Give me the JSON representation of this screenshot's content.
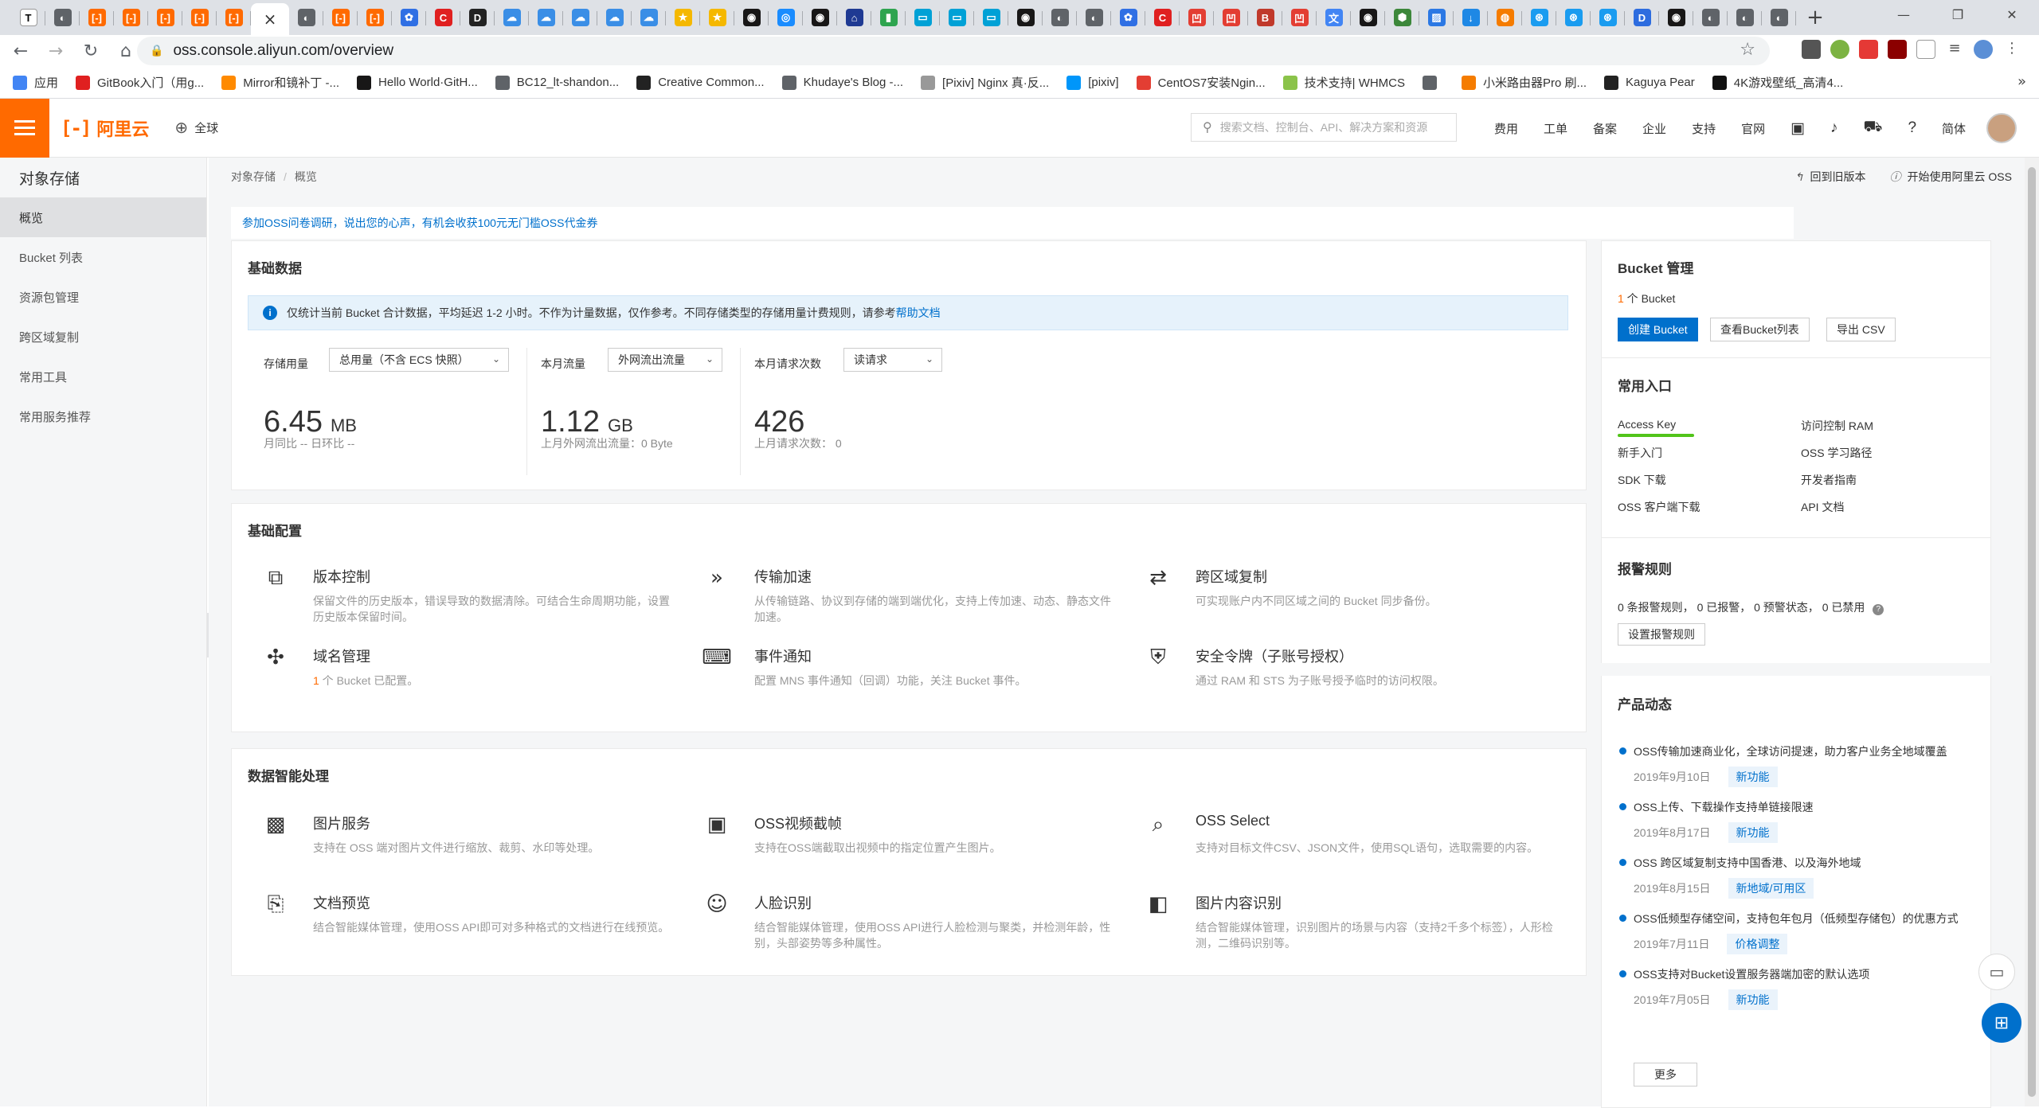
{
  "browser": {
    "tabs": [
      {
        "icon": "text-icon",
        "letter": "T",
        "color": "#ffffff",
        "fg": "#000"
      },
      {
        "icon": "globe-icon",
        "letter": "◐",
        "color": "#5f6368",
        "fg": "#fff"
      },
      {
        "icon": "aliyun-icon",
        "letter": "[-]",
        "color": "#ff6a00",
        "fg": "#fff"
      },
      {
        "icon": "aliyun-icon",
        "letter": "[-]",
        "color": "#ff6a00",
        "fg": "#fff"
      },
      {
        "icon": "aliyun-icon",
        "letter": "[-]",
        "color": "#ff6a00",
        "fg": "#fff"
      },
      {
        "icon": "aliyun-icon",
        "letter": "[-]",
        "color": "#ff6a00",
        "fg": "#fff"
      },
      {
        "icon": "aliyun-icon",
        "letter": "[-]",
        "color": "#ff6a00",
        "fg": "#fff"
      },
      {
        "icon": "close-icon",
        "letter": "×",
        "active": true
      },
      {
        "icon": "globe-icon",
        "letter": "◐",
        "color": "#5f6368",
        "fg": "#fff"
      },
      {
        "icon": "aliyun-icon",
        "letter": "[-]",
        "color": "#ff6a00",
        "fg": "#fff"
      },
      {
        "icon": "aliyun-icon",
        "letter": "[-]",
        "color": "#ff6a00",
        "fg": "#fff"
      },
      {
        "icon": "settings-icon",
        "letter": "✿",
        "color": "#2f6fe4",
        "fg": "#fff"
      },
      {
        "icon": "cloud-c-icon",
        "letter": "C",
        "color": "#e02020",
        "fg": "#fff"
      },
      {
        "icon": "d-icon",
        "letter": "D",
        "color": "#222",
        "fg": "#fff"
      },
      {
        "icon": "cloud-icon",
        "letter": "☁",
        "color": "#3a8ee6",
        "fg": "#fff"
      },
      {
        "icon": "cloud-icon",
        "letter": "☁",
        "color": "#3a8ee6",
        "fg": "#fff"
      },
      {
        "icon": "cloud-icon",
        "letter": "☁",
        "color": "#3a8ee6",
        "fg": "#fff"
      },
      {
        "icon": "cloud-icon",
        "letter": "☁",
        "color": "#3a8ee6",
        "fg": "#fff"
      },
      {
        "icon": "cloud-icon",
        "letter": "☁",
        "color": "#3a8ee6",
        "fg": "#fff"
      },
      {
        "icon": "star-icon",
        "letter": "★",
        "color": "#f5b800",
        "fg": "#fff"
      },
      {
        "icon": "star-icon",
        "letter": "★",
        "color": "#f5b800",
        "fg": "#fff"
      },
      {
        "icon": "github-icon",
        "letter": "◉",
        "color": "#181717",
        "fg": "#fff"
      },
      {
        "icon": "blue-circle-icon",
        "letter": "◎",
        "color": "#1a8cff",
        "fg": "#fff"
      },
      {
        "icon": "github-icon",
        "letter": "◉",
        "color": "#181717",
        "fg": "#fff"
      },
      {
        "icon": "house-icon",
        "letter": "⌂",
        "color": "#1f3a93",
        "fg": "#fff"
      },
      {
        "icon": "chart-icon",
        "letter": "▮",
        "color": "#2ea44f",
        "fg": "#fff"
      },
      {
        "icon": "tv-icon",
        "letter": "▭",
        "color": "#00a1d6",
        "fg": "#fff"
      },
      {
        "icon": "tv-icon",
        "letter": "▭",
        "color": "#00a1d6",
        "fg": "#fff"
      },
      {
        "icon": "tv-icon",
        "letter": "▭",
        "color": "#00a1d6",
        "fg": "#fff"
      },
      {
        "icon": "github-icon",
        "letter": "◉",
        "color": "#181717",
        "fg": "#fff"
      },
      {
        "icon": "globe-icon",
        "letter": "◐",
        "color": "#5f6368",
        "fg": "#fff"
      },
      {
        "icon": "globe-icon",
        "letter": "◐",
        "color": "#5f6368",
        "fg": "#fff"
      },
      {
        "icon": "settings-icon",
        "letter": "✿",
        "color": "#2f6fe4",
        "fg": "#fff"
      },
      {
        "icon": "cloud-c-icon",
        "letter": "C",
        "color": "#e02020",
        "fg": "#fff"
      },
      {
        "icon": "csdn-icon",
        "letter": "凹",
        "color": "#e33e33",
        "fg": "#fff"
      },
      {
        "icon": "csdn-icon",
        "letter": "凹",
        "color": "#e33e33",
        "fg": "#fff"
      },
      {
        "icon": "b-icon",
        "letter": "B",
        "color": "#c0392b",
        "fg": "#fff"
      },
      {
        "icon": "csdn-icon",
        "letter": "凹",
        "color": "#e33e33",
        "fg": "#fff"
      },
      {
        "icon": "translate-icon",
        "letter": "文",
        "color": "#4285f4",
        "fg": "#fff"
      },
      {
        "icon": "github-icon",
        "letter": "◉",
        "color": "#181717",
        "fg": "#fff"
      },
      {
        "icon": "hexagon-icon",
        "letter": "⬢",
        "color": "#3c873a",
        "fg": "#fff"
      },
      {
        "icon": "image-icon",
        "letter": "▨",
        "color": "#2b78e4",
        "fg": "#fff"
      },
      {
        "icon": "download-icon",
        "letter": "↓",
        "color": "#1e88e5",
        "fg": "#fff"
      },
      {
        "icon": "orange-icon",
        "letter": "◍",
        "color": "#f57c00",
        "fg": "#fff"
      },
      {
        "icon": "spiral-icon",
        "letter": "⊛",
        "color": "#1a9cf0",
        "fg": "#fff"
      },
      {
        "icon": "spiral-icon",
        "letter": "⊛",
        "color": "#1a9cf0",
        "fg": "#fff"
      },
      {
        "icon": "spiral-icon",
        "letter": "⊛",
        "color": "#1a9cf0",
        "fg": "#fff"
      },
      {
        "icon": "d-icon",
        "letter": "D",
        "color": "#2d6cdf",
        "fg": "#fff"
      },
      {
        "icon": "github-icon",
        "letter": "◉",
        "color": "#181717",
        "fg": "#fff"
      },
      {
        "icon": "globe-icon",
        "letter": "◐",
        "color": "#5f6368",
        "fg": "#fff"
      },
      {
        "icon": "globe-icon",
        "letter": "◐",
        "color": "#5f6368",
        "fg": "#fff"
      },
      {
        "icon": "globe-icon",
        "letter": "◐",
        "color": "#5f6368",
        "fg": "#fff"
      }
    ],
    "new_tab": "+",
    "url": "oss.console.aliyun.com/overview",
    "bookmarks": [
      {
        "label": "应用",
        "color": "#4285f4"
      },
      {
        "label": "GitBook入门（用g...",
        "color": "#e02020"
      },
      {
        "label": "Mirror和镜补丁 -...",
        "color": "#ff8a00"
      },
      {
        "label": "Hello World·GitH...",
        "color": "#181717"
      },
      {
        "label": "BC12_lt-shandon...",
        "color": "#5f6368"
      },
      {
        "label": "Creative Common...",
        "color": "#222"
      },
      {
        "label": "Khudaye's Blog -...",
        "color": "#5f6368"
      },
      {
        "label": "[Pixiv] Nginx 真·反...",
        "color": "#999"
      },
      {
        "label": "[pixiv]",
        "color": "#0096fa"
      },
      {
        "label": "CentOS7安装Ngin...",
        "color": "#e33e33"
      },
      {
        "label": "技术支持| WHMCS",
        "color": "#8bc34a"
      },
      {
        "label": "",
        "color": "#5f6368"
      },
      {
        "label": "小米路由器Pro 刷...",
        "color": "#f57c00"
      },
      {
        "label": "Kaguya Pear",
        "color": "#222"
      },
      {
        "label": "4K游戏壁纸_高清4...",
        "color": "#111"
      }
    ]
  },
  "header": {
    "brand": "阿里云",
    "brand_mark": "[-]",
    "region": "全球",
    "search_placeholder": "搜索文档、控制台、API、解决方案和资源",
    "nav": [
      "费用",
      "工单",
      "备案",
      "企业",
      "支持",
      "官网"
    ],
    "lang": "简体"
  },
  "sidebar": {
    "title": "对象存储",
    "items": [
      "概览",
      "Bucket 列表",
      "资源包管理",
      "跨区域复制",
      "常用工具",
      "常用服务推荐"
    ]
  },
  "main": {
    "breadcrumb": [
      "对象存储",
      "概览"
    ],
    "top_links": [
      "回到旧版本",
      "开始使用阿里云 OSS"
    ],
    "notice": "参加OSS问卷调研，说出您的心声，有机会收获100元无门槛OSS代金券",
    "basic_data": {
      "title": "基础数据",
      "info": "仅统计当前 Bucket 合计数据，平均延迟 1-2 小时。不作为计量数据，仅作参考。不同存储类型的存储用量计费规则，请参考",
      "info_link": "帮助文档",
      "stats": [
        {
          "label": "存储用量",
          "select": "总用量（不含 ECS 快照）",
          "value": "6.45",
          "unit": "MB",
          "sub": "月同比 --   日环比 --"
        },
        {
          "label": "本月流量",
          "select": "外网流出流量",
          "value": "1.12",
          "unit": "GB",
          "sub": "上月外网流出流量：0 Byte"
        },
        {
          "label": "本月请求次数",
          "select": "读请求",
          "value": "426",
          "unit": "",
          "sub": "上月请求次数：  0"
        }
      ]
    },
    "basic_config": {
      "title": "基础配置",
      "items": [
        {
          "icon": "copy-icon",
          "glyph": "⧉",
          "title": "版本控制",
          "desc": "保留文件的历史版本，错误导致的数据清除。可结合生命周期功能，设置历史版本保留时间。"
        },
        {
          "icon": "double-chevron-icon",
          "glyph": "»",
          "title": "传输加速",
          "desc": "从传输链路、协议到存储的端到端优化，支持上传加速、动态、静态文件加速。"
        },
        {
          "icon": "cross-region-icon",
          "glyph": "⇄",
          "title": "跨区域复制",
          "desc": "可实现账户内不同区域之间的 Bucket 同步备份。"
        },
        {
          "icon": "domain-icon",
          "glyph": "✣",
          "title": "域名管理",
          "desc_hl": "1",
          "desc": " 个 Bucket 已配置。"
        },
        {
          "icon": "event-icon",
          "glyph": "⌨",
          "title": "事件通知",
          "desc": "配置 MNS 事件通知（回调）功能，关注 Bucket 事件。"
        },
        {
          "icon": "shield-icon",
          "glyph": "⛨",
          "title": "安全令牌（子账号授权）",
          "desc": "通过 RAM 和 STS 为子账号授予临时的访问权限。"
        }
      ]
    },
    "data_processing": {
      "title": "数据智能处理",
      "items": [
        {
          "icon": "image-service-icon",
          "glyph": "▩",
          "title": "图片服务",
          "desc": "支持在 OSS 端对图片文件进行缩放、裁剪、水印等处理。"
        },
        {
          "icon": "video-snapshot-icon",
          "glyph": "▣",
          "title": "OSS视频截帧",
          "desc": "支持在OSS端截取出视频中的指定位置产生图片。"
        },
        {
          "icon": "select-icon",
          "glyph": "⌕",
          "title": "OSS Select",
          "desc": "支持对目标文件CSV、JSON文件，使用SQL语句，选取需要的内容。"
        },
        {
          "icon": "doc-preview-icon",
          "glyph": "⎘",
          "title": "文档预览",
          "desc": "结合智能媒体管理，使用OSS API即可对多种格式的文档进行在线预览。"
        },
        {
          "icon": "face-icon",
          "glyph": "☺",
          "title": "人脸识别",
          "desc": "结合智能媒体管理，使用OSS API进行人脸检测与聚类，并检测年龄，性别，头部姿势等多种属性。"
        },
        {
          "icon": "image-recognition-icon",
          "glyph": "◧",
          "title": "图片内容识别",
          "desc": "结合智能媒体管理，识别图片的场景与内容（支持2千多个标签），人形检测，二维码识别等。"
        }
      ]
    }
  },
  "right": {
    "bucket": {
      "title": "Bucket 管理",
      "count": "1",
      "count_label": " 个 Bucket",
      "buttons": [
        "创建 Bucket",
        "查看Bucket列表",
        "导出 CSV"
      ]
    },
    "common": {
      "title": "常用入口",
      "links": [
        "Access Key",
        "访问控制 RAM",
        "新手入门",
        "OSS 学习路径",
        "SDK 下载",
        "开发者指南",
        "OSS 客户端下载",
        "API 文档"
      ]
    },
    "alarm": {
      "title": "报警规则",
      "summary": "0 条报警规则， 0 已报警， 0 预警状态， 0 已禁用",
      "button": "设置报警规则"
    },
    "news": {
      "title": "产品动态",
      "items": [
        {
          "text": "OSS传输加速商业化，全球访问提速，助力客户业务全地域覆盖",
          "date": "2019年9月10日",
          "tag": "新功能"
        },
        {
          "text": "OSS上传、下载操作支持单链接限速",
          "date": "2019年8月17日",
          "tag": "新功能"
        },
        {
          "text": "OSS 跨区域复制支持中国香港、以及海外地域",
          "date": "2019年8月15日",
          "tag": "新地域/可用区"
        },
        {
          "text": "OSS低频型存储空间，支持包年包月（低频型存储包）的优惠方式",
          "date": "2019年7月11日",
          "tag": "价格调整"
        },
        {
          "text": "OSS支持对Bucket设置服务器端加密的默认选项",
          "date": "2019年7月05日",
          "tag": "新功能"
        }
      ],
      "more": "更多"
    }
  },
  "colors": {
    "accent": "#ff6a00",
    "primary": "#0070cc",
    "highlight_underline": "#52c41a"
  }
}
